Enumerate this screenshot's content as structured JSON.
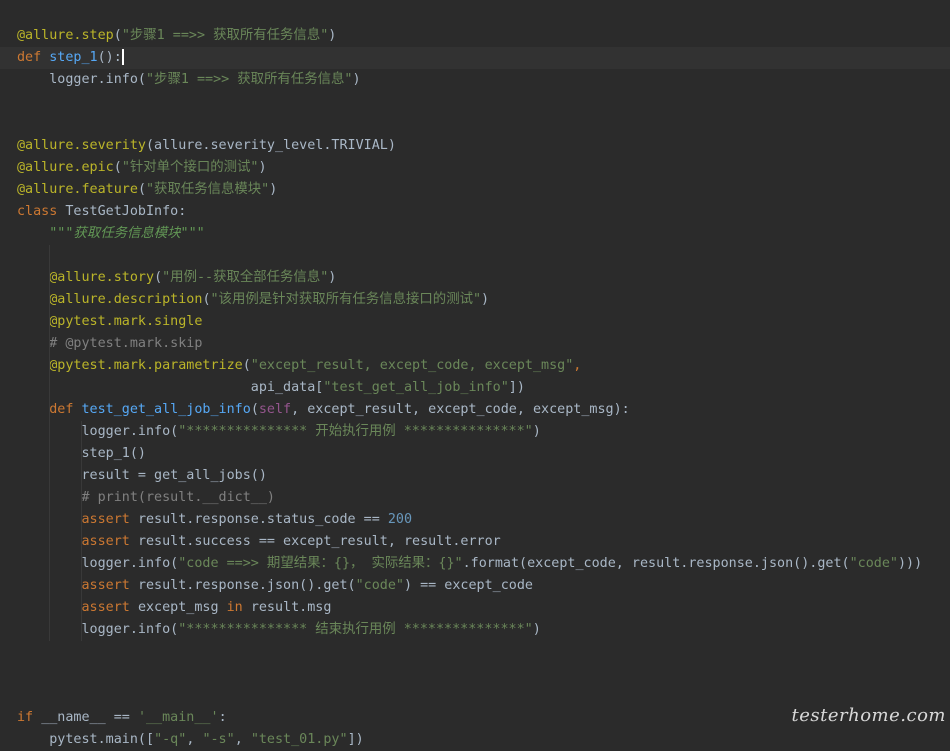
{
  "watermark": "testerhome.com",
  "lines": [
    {
      "tokens": [
        {
          "t": "@allure.step",
          "c": "dec"
        },
        {
          "t": "(",
          "c": ""
        },
        {
          "t": "\"步骤1 ==>> 获取所有任务信息\"",
          "c": "str"
        },
        {
          "t": ")",
          "c": ""
        }
      ]
    },
    {
      "current": true,
      "cursor": true,
      "tokens": [
        {
          "t": "def ",
          "c": "kw"
        },
        {
          "t": "step_1",
          "c": "def"
        },
        {
          "t": "():",
          "c": ""
        }
      ]
    },
    {
      "tokens": [
        {
          "t": "    logger.info(",
          "c": ""
        },
        {
          "t": "\"步骤1 ==>> 获取所有任务信息\"",
          "c": "str"
        },
        {
          "t": ")",
          "c": ""
        }
      ]
    },
    {
      "tokens": []
    },
    {
      "tokens": []
    },
    {
      "tokens": [
        {
          "t": "@allure.severity",
          "c": "dec"
        },
        {
          "t": "(allure.severity_level.TRIVIAL)",
          "c": ""
        }
      ]
    },
    {
      "tokens": [
        {
          "t": "@allure.epic",
          "c": "dec"
        },
        {
          "t": "(",
          "c": ""
        },
        {
          "t": "\"针对单个接口的测试\"",
          "c": "str"
        },
        {
          "t": ")",
          "c": ""
        }
      ]
    },
    {
      "tokens": [
        {
          "t": "@allure.feature",
          "c": "dec"
        },
        {
          "t": "(",
          "c": ""
        },
        {
          "t": "\"获取任务信息模块\"",
          "c": "str"
        },
        {
          "t": ")",
          "c": ""
        }
      ]
    },
    {
      "tokens": [
        {
          "t": "class ",
          "c": "kw"
        },
        {
          "t": "TestGetJobInfo:",
          "c": ""
        }
      ]
    },
    {
      "tokens": [
        {
          "t": "    ",
          "c": ""
        },
        {
          "t": "\"\"\"获取任务信息模块\"\"\"",
          "c": "doc"
        }
      ]
    },
    {
      "tokens": []
    },
    {
      "tokens": [
        {
          "t": "    ",
          "c": ""
        },
        {
          "t": "@allure.story",
          "c": "dec"
        },
        {
          "t": "(",
          "c": ""
        },
        {
          "t": "\"用例--获取全部任务信息\"",
          "c": "str"
        },
        {
          "t": ")",
          "c": ""
        }
      ]
    },
    {
      "tokens": [
        {
          "t": "    ",
          "c": ""
        },
        {
          "t": "@allure.description",
          "c": "dec"
        },
        {
          "t": "(",
          "c": ""
        },
        {
          "t": "\"该用例是针对获取所有任务信息接口的测试\"",
          "c": "str"
        },
        {
          "t": ")",
          "c": ""
        }
      ]
    },
    {
      "tokens": [
        {
          "t": "    ",
          "c": ""
        },
        {
          "t": "@pytest.mark.single",
          "c": "dec"
        }
      ]
    },
    {
      "tokens": [
        {
          "t": "    ",
          "c": ""
        },
        {
          "t": "# @pytest.mark.skip",
          "c": "com"
        }
      ]
    },
    {
      "tokens": [
        {
          "t": "    ",
          "c": ""
        },
        {
          "t": "@pytest.mark.parametrize",
          "c": "dec"
        },
        {
          "t": "(",
          "c": ""
        },
        {
          "t": "\"except_result, except_code, except_msg\"",
          "c": "str"
        },
        {
          "t": ",",
          "c": "kw"
        }
      ]
    },
    {
      "tokens": [
        {
          "t": "                             api_data[",
          "c": ""
        },
        {
          "t": "\"test_get_all_job_info\"",
          "c": "str"
        },
        {
          "t": "])",
          "c": ""
        }
      ]
    },
    {
      "tokens": [
        {
          "t": "    ",
          "c": ""
        },
        {
          "t": "def ",
          "c": "kw"
        },
        {
          "t": "test_get_all_job_info",
          "c": "def"
        },
        {
          "t": "(",
          "c": ""
        },
        {
          "t": "self",
          "c": "self"
        },
        {
          "t": ", except_result, except_code, except_msg):",
          "c": ""
        }
      ]
    },
    {
      "tokens": [
        {
          "t": "        logger.info(",
          "c": ""
        },
        {
          "t": "\"*************** 开始执行用例 ***************\"",
          "c": "str"
        },
        {
          "t": ")",
          "c": ""
        }
      ]
    },
    {
      "tokens": [
        {
          "t": "        step_1()",
          "c": ""
        }
      ]
    },
    {
      "tokens": [
        {
          "t": "        result = get_all_jobs()",
          "c": ""
        }
      ]
    },
    {
      "tokens": [
        {
          "t": "        ",
          "c": ""
        },
        {
          "t": "# print(result.__dict__)",
          "c": "com"
        }
      ]
    },
    {
      "tokens": [
        {
          "t": "        ",
          "c": ""
        },
        {
          "t": "assert ",
          "c": "kw"
        },
        {
          "t": "result.response.status_code == ",
          "c": ""
        },
        {
          "t": "200",
          "c": "num"
        }
      ]
    },
    {
      "tokens": [
        {
          "t": "        ",
          "c": ""
        },
        {
          "t": "assert ",
          "c": "kw"
        },
        {
          "t": "result.success == except_result, result.error",
          "c": ""
        }
      ]
    },
    {
      "tokens": [
        {
          "t": "        logger.info(",
          "c": ""
        },
        {
          "t": "\"code ==>> 期望结果：{}， 实际结果：{}\"",
          "c": "str"
        },
        {
          "t": ".format(except_code, result.response.json().get(",
          "c": ""
        },
        {
          "t": "\"code\"",
          "c": "str"
        },
        {
          "t": ")))",
          "c": ""
        }
      ]
    },
    {
      "tokens": [
        {
          "t": "        ",
          "c": ""
        },
        {
          "t": "assert ",
          "c": "kw"
        },
        {
          "t": "result.response.json().get(",
          "c": ""
        },
        {
          "t": "\"code\"",
          "c": "str"
        },
        {
          "t": ") == except_code",
          "c": ""
        }
      ]
    },
    {
      "tokens": [
        {
          "t": "        ",
          "c": ""
        },
        {
          "t": "assert ",
          "c": "kw"
        },
        {
          "t": "except_msg ",
          "c": ""
        },
        {
          "t": "in ",
          "c": "kw"
        },
        {
          "t": "result.msg",
          "c": ""
        }
      ]
    },
    {
      "tokens": [
        {
          "t": "        logger.info(",
          "c": ""
        },
        {
          "t": "\"*************** 结束执行用例 ***************\"",
          "c": "str"
        },
        {
          "t": ")",
          "c": ""
        }
      ]
    },
    {
      "tokens": []
    },
    {
      "tokens": []
    },
    {
      "tokens": []
    },
    {
      "tokens": [
        {
          "t": "if ",
          "c": "kw"
        },
        {
          "t": "__name__ == ",
          "c": ""
        },
        {
          "t": "'__main__'",
          "c": "str"
        },
        {
          "t": ":",
          "c": ""
        }
      ]
    },
    {
      "tokens": [
        {
          "t": "    pytest.main([",
          "c": ""
        },
        {
          "t": "\"-q\"",
          "c": "str"
        },
        {
          "t": ", ",
          "c": ""
        },
        {
          "t": "\"-s\"",
          "c": "str"
        },
        {
          "t": ", ",
          "c": ""
        },
        {
          "t": "\"test_01.py\"",
          "c": "str"
        },
        {
          "t": "])",
          "c": ""
        }
      ]
    }
  ]
}
